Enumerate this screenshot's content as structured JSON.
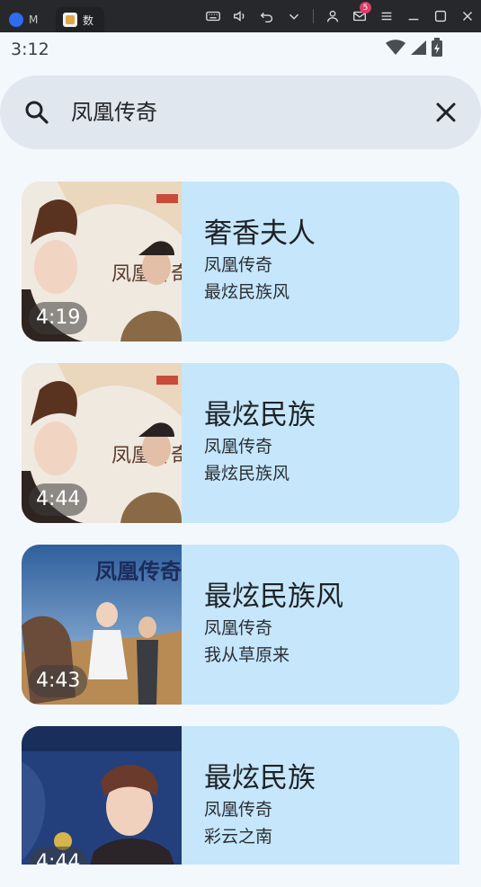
{
  "window": {
    "tab1_label": "M",
    "tab2_label": "数",
    "mail_badge": "5"
  },
  "status": {
    "time": "3:12"
  },
  "search": {
    "query": "凤凰传奇"
  },
  "results": [
    {
      "title": "奢香夫人",
      "artist": "凤凰传奇",
      "album": "最炫民族风",
      "duration": "4:19"
    },
    {
      "title": "最炫民族",
      "artist": "凤凰传奇",
      "album": "最炫民族风",
      "duration": "4:44"
    },
    {
      "title": "最炫民族风",
      "artist": "凤凰传奇",
      "album": "我从草原来",
      "duration": "4:43"
    },
    {
      "title": "最炫民族",
      "artist": "凤凰传奇",
      "album": "彩云之南",
      "duration": "4:44"
    }
  ],
  "colors": {
    "card_bg": "#c5e6fb",
    "search_bg": "#e1e7ee",
    "page_bg": "#f3f8fd",
    "titlebar_bg": "#26282c"
  }
}
